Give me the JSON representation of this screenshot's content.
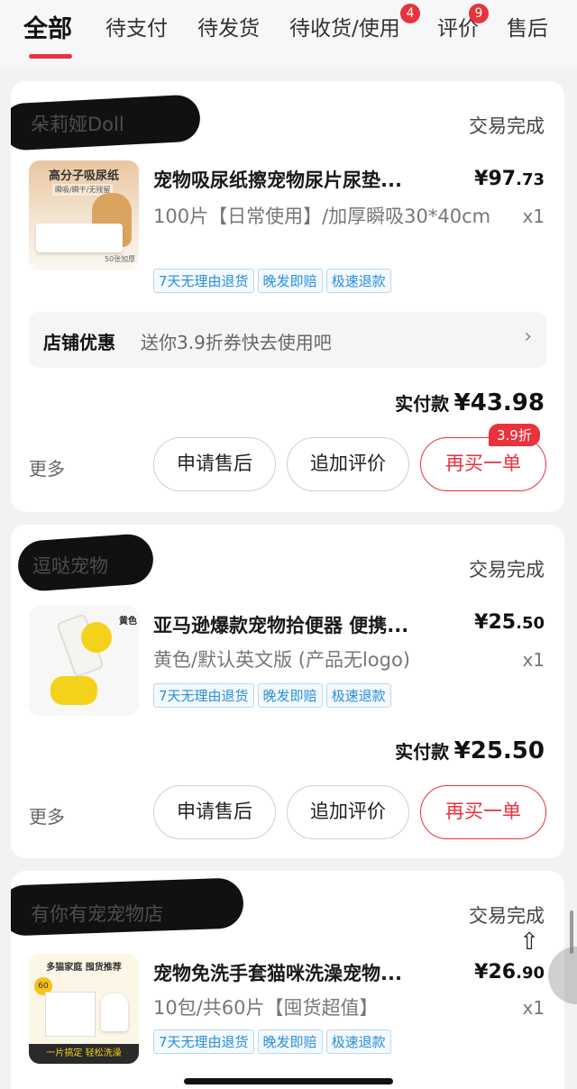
{
  "tabs": {
    "all": "全部",
    "pending_pay": "待支付",
    "pending_ship": "待发货",
    "pending_receive": "待收货/使用",
    "pending_receive_badge": "4",
    "review": "评价",
    "review_badge": "9",
    "after_sale": "售后"
  },
  "orders": [
    {
      "store": "朵莉娅Doll",
      "status": "交易完成",
      "product_title": "宠物吸尿纸擦宠物尿片尿垫...",
      "price_int": "¥97",
      "price_dec": ".73",
      "spec": "100片【日常使用】/加厚瞬吸30*40cm",
      "qty": "x1",
      "thumb_text": "高分子吸尿纸",
      "thumb_sub": "瞬吸/瞬干/无残留",
      "thumb_corner": "50张加厚",
      "tags": [
        "7天无理由退货",
        "晚发即赔",
        "极速退款"
      ],
      "promo_label": "店铺优惠",
      "promo_text": "送你3.9折券快去使用吧",
      "paid_label": "实付款",
      "paid_amount": "¥43.98",
      "more": "更多",
      "btn_aftersale": "申请售后",
      "btn_review": "追加评价",
      "btn_rebuy": "再买一单",
      "rebuy_badge": "3.9折"
    },
    {
      "store": "逗哒宠物",
      "status": "交易完成",
      "product_title": "亚马逊爆款宠物拾便器 便携...",
      "price_int": "¥25",
      "price_dec": ".50",
      "spec": "黄色/默认英文版 (产品无logo)",
      "qty": "x1",
      "thumb_text": "黄色",
      "tags": [
        "7天无理由退货",
        "晚发即赔",
        "极速退款"
      ],
      "paid_label": "实付款",
      "paid_amount": "¥25.50",
      "more": "更多",
      "btn_aftersale": "申请售后",
      "btn_review": "追加评价",
      "btn_rebuy": "再买一单"
    },
    {
      "store": "有你有宠宠物店",
      "status": "交易完成",
      "product_title": "宠物免洗手套猫咪洗澡宠物...",
      "price_int": "¥26",
      "price_dec": ".90",
      "spec": "10包/共60片【囤货超值】",
      "qty": "x1",
      "thumb_text": "多猫家庭 囤货推荐",
      "thumb_bottom": "一片搞定 轻松洗澡",
      "thumb_badge": "60",
      "tags": [
        "7天无理由退货",
        "晚发即赔",
        "极速退款"
      ]
    }
  ],
  "colors": {
    "accent": "#e8323c",
    "tag_blue": "#2a8ed8"
  },
  "icons": {
    "promo_chevron": "chevron-right-icon",
    "float": "up-arrow-icon"
  }
}
